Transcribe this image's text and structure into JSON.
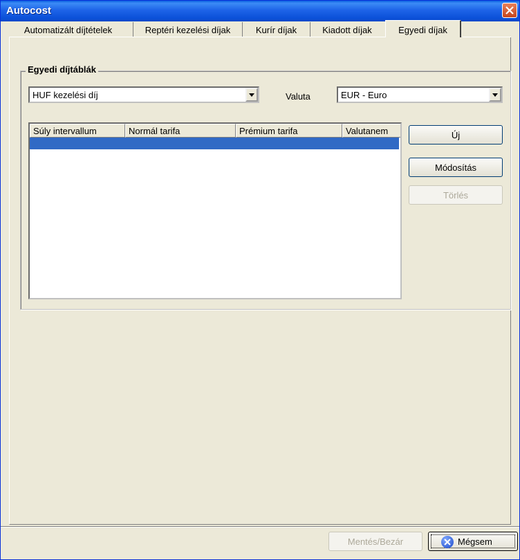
{
  "window": {
    "title": "Autocost",
    "accent": "#0a5fe0",
    "close_icon": "close-icon"
  },
  "tabs": [
    {
      "label": "Automatizált díjtételek"
    },
    {
      "label": "Reptéri kezelési díjak"
    },
    {
      "label": "Kurír díjak"
    },
    {
      "label": "Kiadott díjak"
    },
    {
      "label": "Egyedi díjak",
      "active": true
    }
  ],
  "group": {
    "title": "Egyedi díjtáblák",
    "fee_type": {
      "selected": "HUF kezelési díj"
    },
    "currency": {
      "label": "Valuta",
      "selected": "EUR - Euro"
    },
    "table": {
      "columns": [
        "Súly intervallum",
        "Normál tarifa",
        "Prémium tarifa",
        "Valutanem"
      ],
      "selection_color": "#316ac5"
    },
    "buttons": {
      "new": "Új",
      "modify": "Módosítás",
      "delete": "Törlés"
    }
  },
  "footer": {
    "save_close": "Mentés/Bezár",
    "cancel": "Mégsem"
  }
}
